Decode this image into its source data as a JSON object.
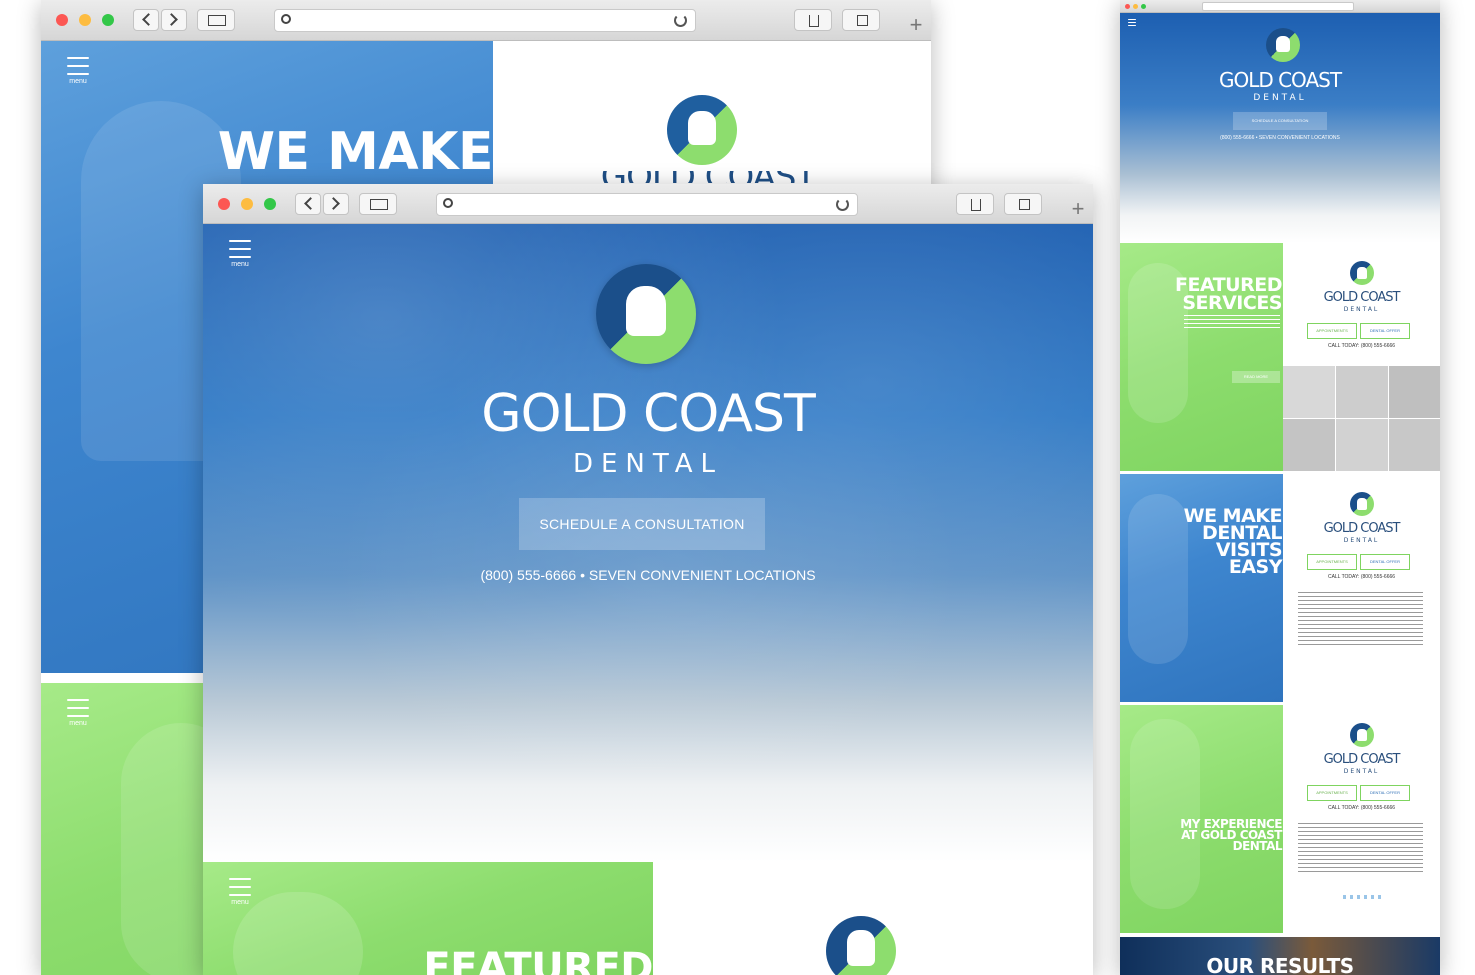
{
  "brand": {
    "name_line1": "GOLD COAST",
    "name_line2": "DENTAL",
    "primary_blue": "#2f6fb6",
    "brand_green": "#8ddd6e"
  },
  "browser": {
    "menu_label": "menu"
  },
  "back_window": {
    "heading": "WE MAKE",
    "logo_partial": "GOLD COAST"
  },
  "main_window": {
    "cta_label": "SCHEDULE A CONSULTATION",
    "contact_line": "(800) 555-6666 • SEVEN CONVENIENT LOCATIONS",
    "featured_heading": "FEATURED"
  },
  "right_column": {
    "hero_cta": "SCHEDULE A CONSULTATION",
    "hero_contact": "(800) 555-6666 • SEVEN CONVENIENT LOCATIONS",
    "panels": [
      {
        "heading_line1": "FEATURED",
        "heading_line2": "SERVICES",
        "read_more": "READ MORE"
      },
      {
        "heading_line1": "WE MAKE",
        "heading_line2": "DENTAL",
        "heading_line3": "VISITS",
        "heading_line4": "EASY"
      },
      {
        "heading_line1": "MY EXPERIENCE",
        "heading_line2": "AT GOLD COAST",
        "heading_line3": "DENTAL"
      }
    ],
    "card_buttons": {
      "appointments": "APPOINTMENTS",
      "offer": "DENTAL OFFER"
    },
    "call_today": "CALL TODAY: (800) 555-6666",
    "results_heading": "OUR RESULTS"
  },
  "icons": [
    "close-dot",
    "minimize-dot",
    "zoom-dot",
    "chevron-left-icon",
    "chevron-right-icon",
    "sidebar-icon",
    "search-icon",
    "reload-icon",
    "share-icon",
    "tabs-icon",
    "plus-icon",
    "hamburger-icon",
    "tooth-logo"
  ]
}
